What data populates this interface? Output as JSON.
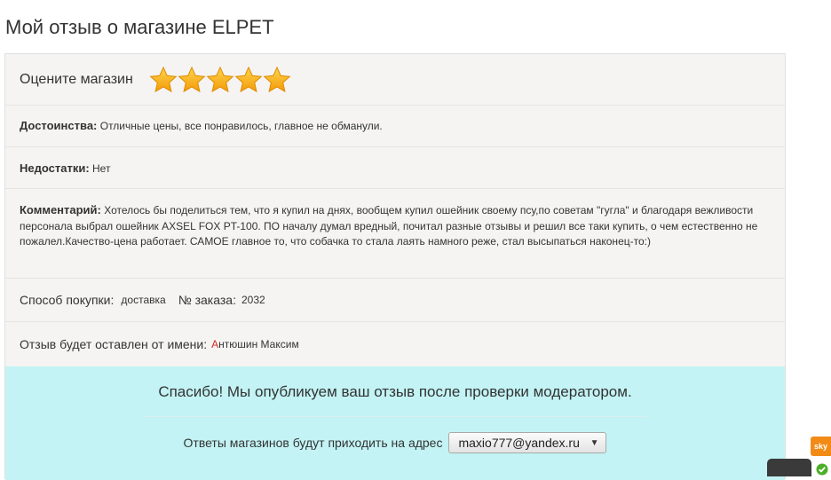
{
  "page": {
    "title": "Мой отзыв о магазине ELPET"
  },
  "rating": {
    "label": "Оцените магазин",
    "stars": 5,
    "max_stars": 5,
    "star_color": "#f7a613"
  },
  "review": {
    "advantages": {
      "label": "Достоинства:",
      "value": "Отличные цены, все понравилось, главное не обманули."
    },
    "disadvantages": {
      "label": "Недостатки:",
      "value": "Нет"
    },
    "comment": {
      "label": "Комментарий:",
      "value": "Хотелось бы поделиться тем, что я купил на днях, вообщем купил ошейник своему псу,по советам \"гугла\" и благодаря вежливости персонала выбрал ошейник AXSEL FOX PT-100. ПО началу думал вредный, почитал разные отзывы и решил все таки купить, о чем естественно не пожалел.Качество-цена работает. САМОЕ главное то, что собачка то стала лаять намного реже, стал высыпаться наконец-то:)"
    },
    "purchase": {
      "label": "Способ покупки:",
      "method": "доставка",
      "order_label": "№ заказа:",
      "order_number": "2032"
    },
    "author": {
      "label": "Отзыв будет оставлен от имени:",
      "name_first_letter": "А",
      "name_rest": "нтюшин Максим"
    }
  },
  "thanks": {
    "message": "Спасибо! Мы опубликуем ваш отзыв после проверки модератором.",
    "address_label": "Ответы магазинов будут приходить на адрес",
    "email": "maxio777@yandex.ru",
    "panel_color": "#c3f3f4"
  },
  "widgets": {
    "skype_label": "sky"
  }
}
